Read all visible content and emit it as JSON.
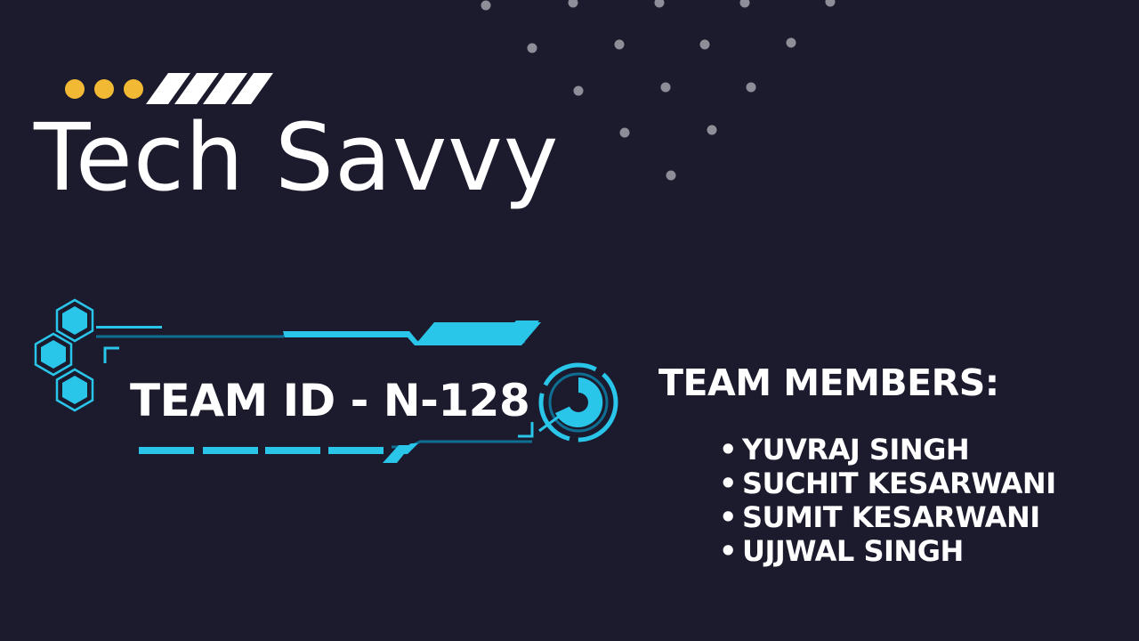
{
  "slide": {
    "title": "Tech Savvy",
    "team_id": "TEAM ID - N-128",
    "members_heading": "TEAM MEMBERS:",
    "members": [
      "YUVRAJ SINGH",
      "SUCHIT KESARWANI",
      "SUMIT KESARWANI",
      "UJJWAL SINGH"
    ],
    "bullet_glyph": "•"
  },
  "colors": {
    "background": "#1c1b2e",
    "text": "#ffffff",
    "accent_dots": "#f2b935",
    "cyan": "#29c6ea",
    "cyan_dark": "#0e6f92",
    "gray_dots": "#8e8e99"
  },
  "icons": [
    "yellow-dot-icon",
    "stripe-icon",
    "hexagon-icon",
    "target-ring-icon"
  ]
}
